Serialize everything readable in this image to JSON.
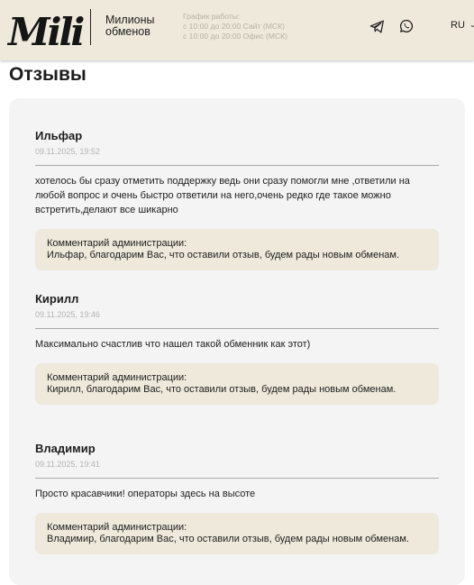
{
  "header": {
    "logo_text": "Mili",
    "tagline_line1": "Милионы",
    "tagline_line2": "обменов",
    "schedule_title": "График работы:",
    "schedule_site": "с 10:00 до 20:00 Сайт (МСК)",
    "schedule_office": "с 10:00 до 20:00 Офис (МСК)",
    "language": "RU"
  },
  "colors": {
    "header_bg": "#efe9dc",
    "panel_bg": "#f4f4f4",
    "admin_bg": "#efe9dc"
  },
  "icons": {
    "chevron": "chevron-down-icon",
    "telegram": "telegram-icon",
    "whatsapp": "whatsapp-icon"
  },
  "page": {
    "title": "Отзывы"
  },
  "reviews": [
    {
      "author": "Ильфар",
      "date": "09.11.2025, 19:52",
      "text": "хотелось бы сразу отметить поддержку ведь они сразу помогли мне ,ответили на любой вопрос и очень быстро ответили на него,очень редко где такое можно встретить,делают все шикарно",
      "admin_label": "Комментарий администрации:",
      "admin_reply": "Ильфар, благодарим Вас, что оставили отзыв, будем рады новым обменам."
    },
    {
      "author": "Кирилл",
      "date": "09.11.2025, 19:46",
      "text": "Максимально счастлив что нашел такой обменник как этот)",
      "admin_label": "Комментарий администрации:",
      "admin_reply": "Кирилл, благодарим Вас, что оставили отзыв, будем рады новым обменам."
    },
    {
      "author": "Владимир",
      "date": "09.11.2025, 19:41",
      "text": "Просто красавчики! операторы здесь на высоте",
      "admin_label": "Комментарий администрации:",
      "admin_reply": "Владимир, благодарим Вас, что оставили отзыв, будем рады новым обменам."
    }
  ]
}
